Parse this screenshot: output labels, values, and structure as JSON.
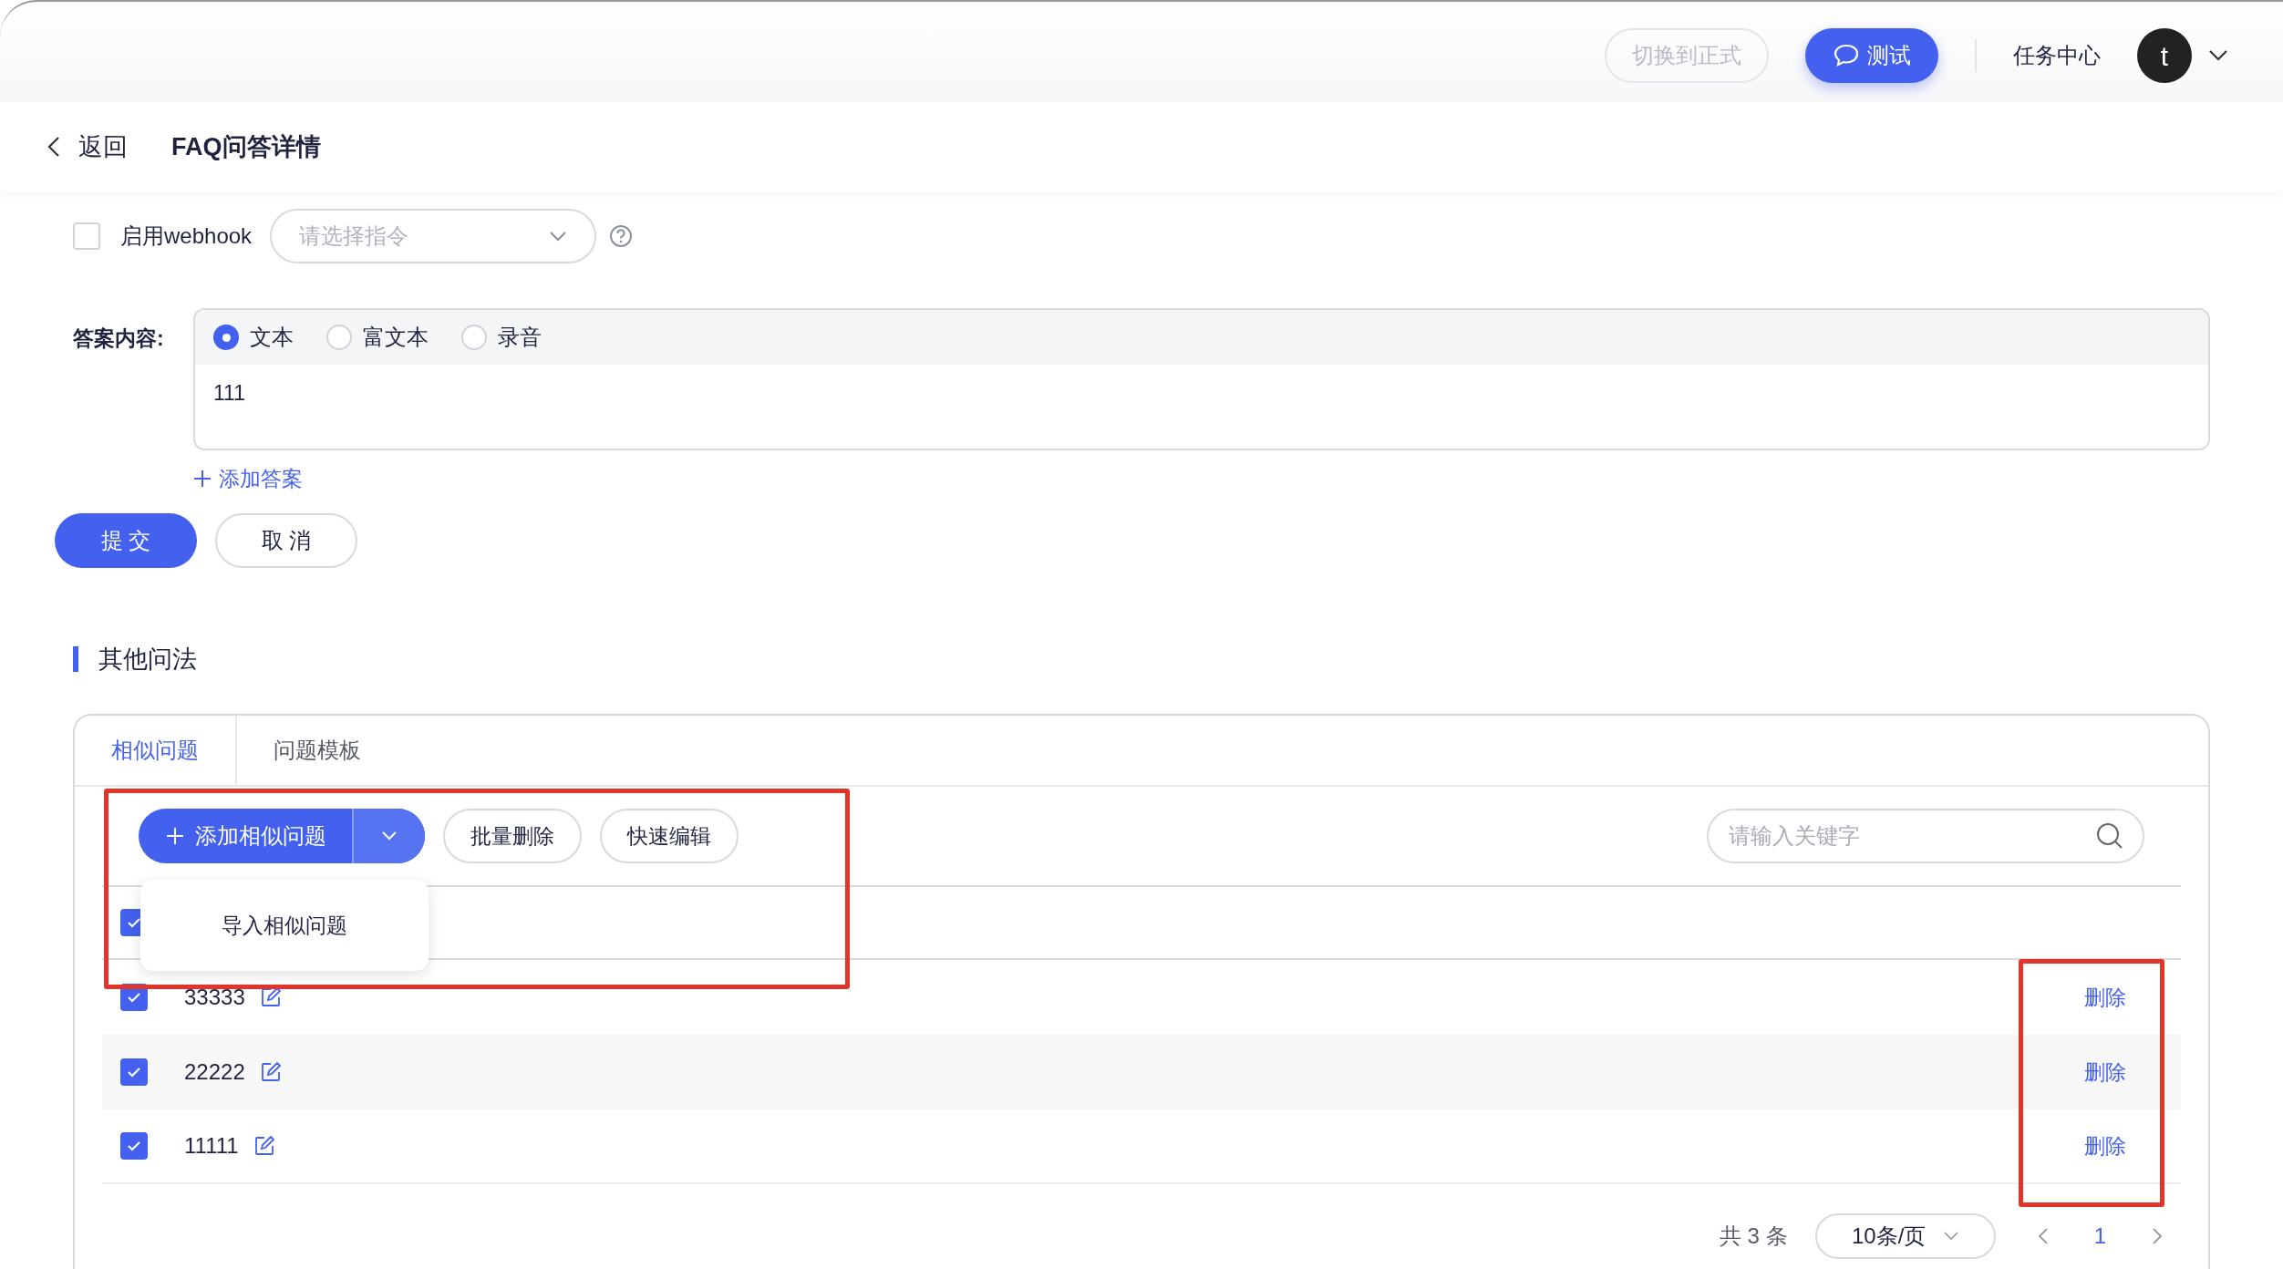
{
  "top_bar": {
    "switch_button": "切换到正式",
    "test_button": "测试",
    "task_center": "任务中心",
    "avatar_letter": "t"
  },
  "header": {
    "back": "返回",
    "title": "FAQ问答详情"
  },
  "webhook": {
    "checked": false,
    "label": "启用webhook",
    "select_placeholder": "请选择指令"
  },
  "answer": {
    "label": "答案内容:",
    "types": [
      {
        "label": "文本",
        "selected": true
      },
      {
        "label": "富文本",
        "selected": false
      },
      {
        "label": "录音",
        "selected": false
      }
    ],
    "value": "111",
    "add_answer": "添加答案"
  },
  "form_buttons": {
    "submit": "提 交",
    "cancel": "取 消"
  },
  "section_title": "其他问法",
  "tabs": [
    {
      "label": "相似问题",
      "selected": true
    },
    {
      "label": "问题模板",
      "selected": false
    }
  ],
  "toolbar": {
    "add_button": "添加相似问题",
    "batch_delete": "批量删除",
    "quick_edit": "快速编辑",
    "search_placeholder": "请输入关键字"
  },
  "dropdown_menu": [
    "导入相似问题"
  ],
  "table": {
    "header_checked": true,
    "rows": [
      {
        "text": "33333",
        "checked": true,
        "action": "删除"
      },
      {
        "text": "22222",
        "checked": true,
        "action": "删除"
      },
      {
        "text": "11111",
        "checked": true,
        "action": "删除"
      }
    ]
  },
  "pagination": {
    "total": "共 3 条",
    "page_size": "10条/页",
    "current_page": "1"
  }
}
